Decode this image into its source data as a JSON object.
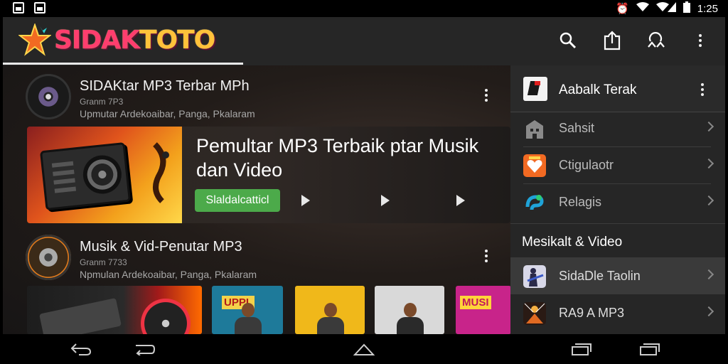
{
  "status_bar": {
    "time": "1:25"
  },
  "app": {
    "logo_text_a": "SIDAK",
    "logo_text_b": "TOTO"
  },
  "main": {
    "rows": [
      {
        "title": "SIDAKtar MP3 Terbar MPh",
        "sub1": "Granm 7P3",
        "sub2": "Upmutar Ardekoaibar, Panga, Pkalaram"
      },
      {
        "title": "Musik & Vid-Penutar MP3",
        "sub1": "Granm 7733",
        "sub2": "Npmulan Ardekoaibar, Panga, Pkalaram"
      }
    ],
    "feature": {
      "title": "Pemultar MP3 Terbaik ptar Musik dan Video",
      "button_label": "Slaldalcatticl"
    },
    "thumbnail_banners": [
      "UPPL",
      "MUSI"
    ]
  },
  "side": {
    "header_label": "Aabalk Terak",
    "items": [
      {
        "label": "Sahsit",
        "icon": "building-icon",
        "color": "#9a9a9a"
      },
      {
        "label": "Ctigulaotr",
        "icon": "heart-badge-icon",
        "color": "#f26a22"
      },
      {
        "label": "Relagis",
        "icon": "swirl-icon",
        "color": "#1fa3d8"
      }
    ],
    "section_label": "Mesikalt & Video",
    "section_items": [
      {
        "label": "SidaDle Taolin",
        "icon": "guitarist-icon"
      },
      {
        "label": "RA9 A MP3",
        "icon": "concert-icon"
      }
    ]
  }
}
